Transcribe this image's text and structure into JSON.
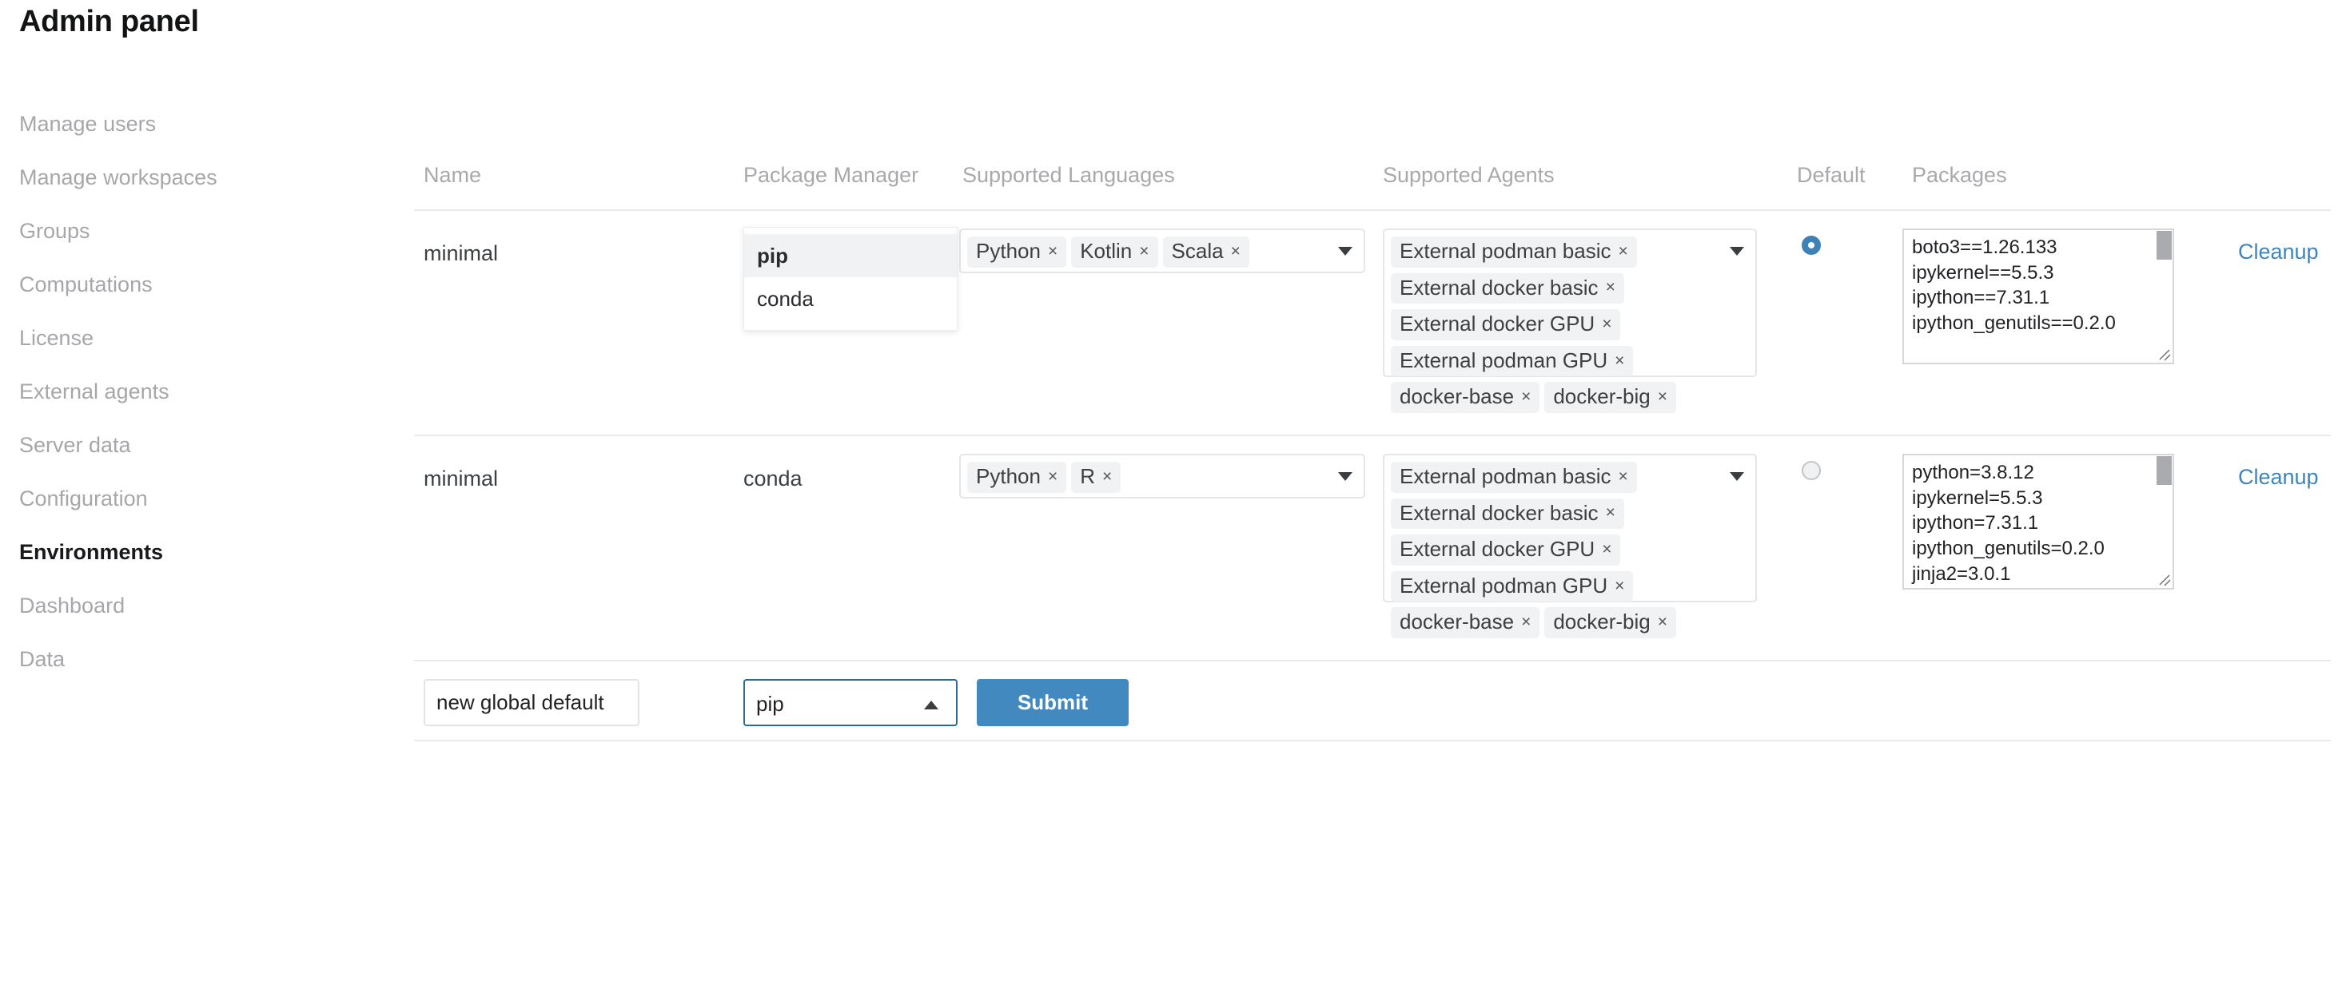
{
  "header": {
    "title": "Admin panel"
  },
  "sidebar": {
    "items": [
      {
        "label": "Manage users",
        "active": false
      },
      {
        "label": "Manage workspaces",
        "active": false
      },
      {
        "label": "Groups",
        "active": false
      },
      {
        "label": "Computations",
        "active": false
      },
      {
        "label": "License",
        "active": false
      },
      {
        "label": "External agents",
        "active": false
      },
      {
        "label": "Server data",
        "active": false
      },
      {
        "label": "Configuration",
        "active": false
      },
      {
        "label": "Environments",
        "active": true
      },
      {
        "label": "Dashboard",
        "active": false
      },
      {
        "label": "Data",
        "active": false
      }
    ]
  },
  "table": {
    "columns": {
      "name": "Name",
      "package_manager": "Package Manager",
      "supported_languages": "Supported Languages",
      "supported_agents": "Supported Agents",
      "default": "Default",
      "packages": "Packages"
    },
    "rows": [
      {
        "name": "minimal",
        "package_manager": "pip",
        "languages": [
          "Python",
          "Kotlin",
          "Scala"
        ],
        "agents": [
          "External podman basic",
          "External docker basic",
          "External docker GPU",
          "External podman GPU",
          "docker-base",
          "docker-big"
        ],
        "is_default": true,
        "packages": "boto3==1.26.133\nipykernel==5.5.3\nipython==7.31.1\nipython_genutils==0.2.0",
        "cleanup_label": "Cleanup"
      },
      {
        "name": "minimal",
        "package_manager": "conda",
        "languages": [
          "Python",
          "R"
        ],
        "agents": [
          "External podman basic",
          "External docker basic",
          "External docker GPU",
          "External podman GPU",
          "docker-base",
          "docker-big"
        ],
        "is_default": false,
        "packages": "python=3.8.12\nipykernel=5.5.3\nipython=7.31.1\nipython_genutils=0.2.0\njinja2=3.0.1",
        "cleanup_label": "Cleanup"
      }
    ]
  },
  "form": {
    "name_value": "new global default",
    "name_placeholder": "new global default",
    "package_manager_selected": "pip",
    "package_manager_options": [
      "pip",
      "conda"
    ],
    "submit_label": "Submit",
    "dropdown_open": true,
    "dropdown_highlighted": "pip"
  },
  "icons": {
    "tag_remove": "×",
    "caret_down": "caret-down-icon",
    "caret_up": "caret-up-icon"
  },
  "colors": {
    "accent_blue": "#4289bf",
    "link_blue": "#3d85be",
    "radio_checked": "#3e81b5",
    "select_focus_border": "#2e6b94",
    "tag_bg": "#f1f2f3",
    "muted_text": "#a7a9ac",
    "border": "#e9eaec"
  }
}
